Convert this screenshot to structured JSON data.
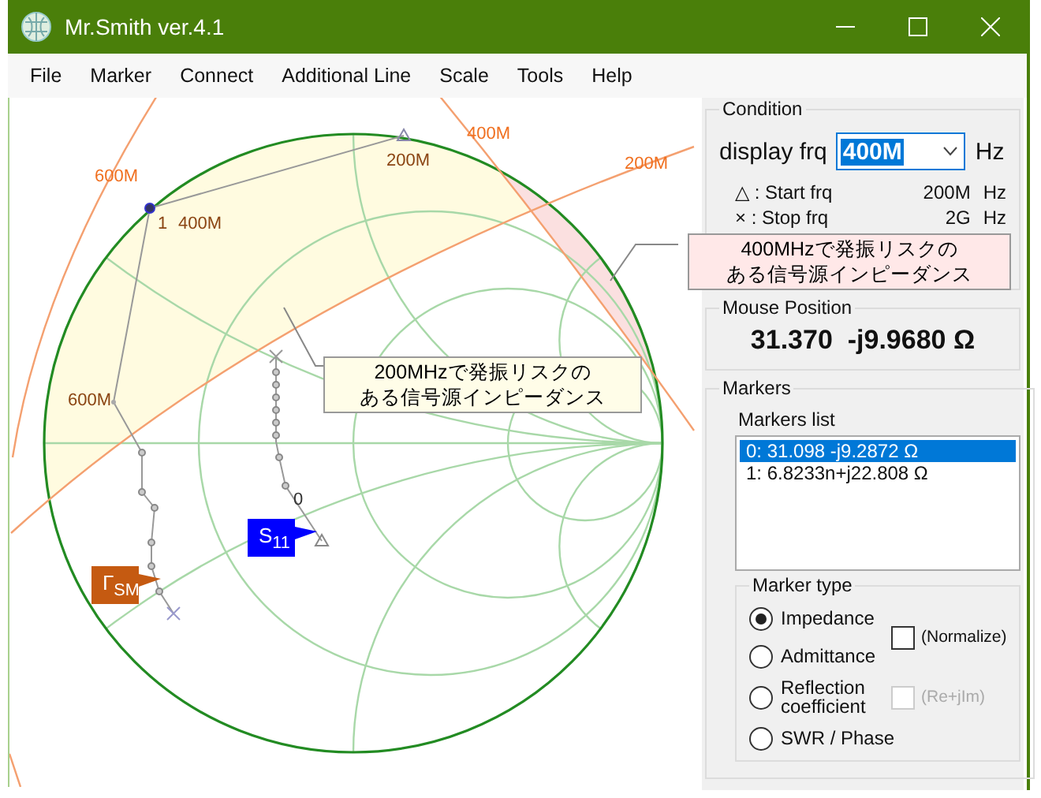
{
  "window": {
    "title": "Mr.Smith ver.4.1"
  },
  "menu": [
    {
      "label": "File"
    },
    {
      "label": "Marker"
    },
    {
      "label": "Connect"
    },
    {
      "label": "Additional Line"
    },
    {
      "label": "Scale"
    },
    {
      "label": "Tools"
    },
    {
      "label": "Help"
    }
  ],
  "chart": {
    "frequency_labels": [
      "600M",
      "400M",
      "200M"
    ],
    "trace_labels": [
      "200M",
      "1",
      "400M",
      "600M",
      "0"
    ],
    "tags": [
      {
        "text": "S$_{11}$",
        "color": "#0000ff"
      },
      {
        "text": "Γ$_{SM}$",
        "color": "#c55a11"
      }
    ],
    "callouts": [
      {
        "lines": [
          "200MHzで発振リスクの",
          "ある信号源インピーダンス"
        ],
        "color": "#fffde8"
      },
      {
        "lines": [
          "400MHzで発振リスクの",
          "ある信号源インピーダンス"
        ],
        "color": "#ffe8e8"
      }
    ]
  },
  "condition": {
    "title": "Condition",
    "display_frq": {
      "label": "display frq",
      "value": "400M",
      "unit": "Hz"
    },
    "rows": [
      {
        "label": "△ : Start frq",
        "value": "200M",
        "unit": "Hz"
      },
      {
        "label": "× : Stop frq",
        "value": "2G",
        "unit": "Hz"
      }
    ]
  },
  "mouse_position": {
    "title": "Mouse Position",
    "value": "31.370  -j9.9680 Ω"
  },
  "markers": {
    "title": "Markers",
    "list_title": "Markers list",
    "items": [
      {
        "text": "0: 31.098 -j9.2872 Ω",
        "selected": true
      },
      {
        "text": "1: 6.8233n+j22.808 Ω",
        "selected": false
      }
    ],
    "type_group": {
      "title": "Marker type",
      "options": [
        {
          "label": "Impedance",
          "selected": true
        },
        {
          "label": "Admittance",
          "selected": false
        },
        {
          "label": "Reflection\ncoefficient",
          "selected": false
        },
        {
          "label": "SWR / Phase",
          "selected": false
        }
      ],
      "checkboxes": [
        {
          "label": "(Normalize)",
          "checked": false,
          "disabled": false
        },
        {
          "label": "(Re+jIm)",
          "checked": false,
          "disabled": true
        }
      ]
    }
  }
}
